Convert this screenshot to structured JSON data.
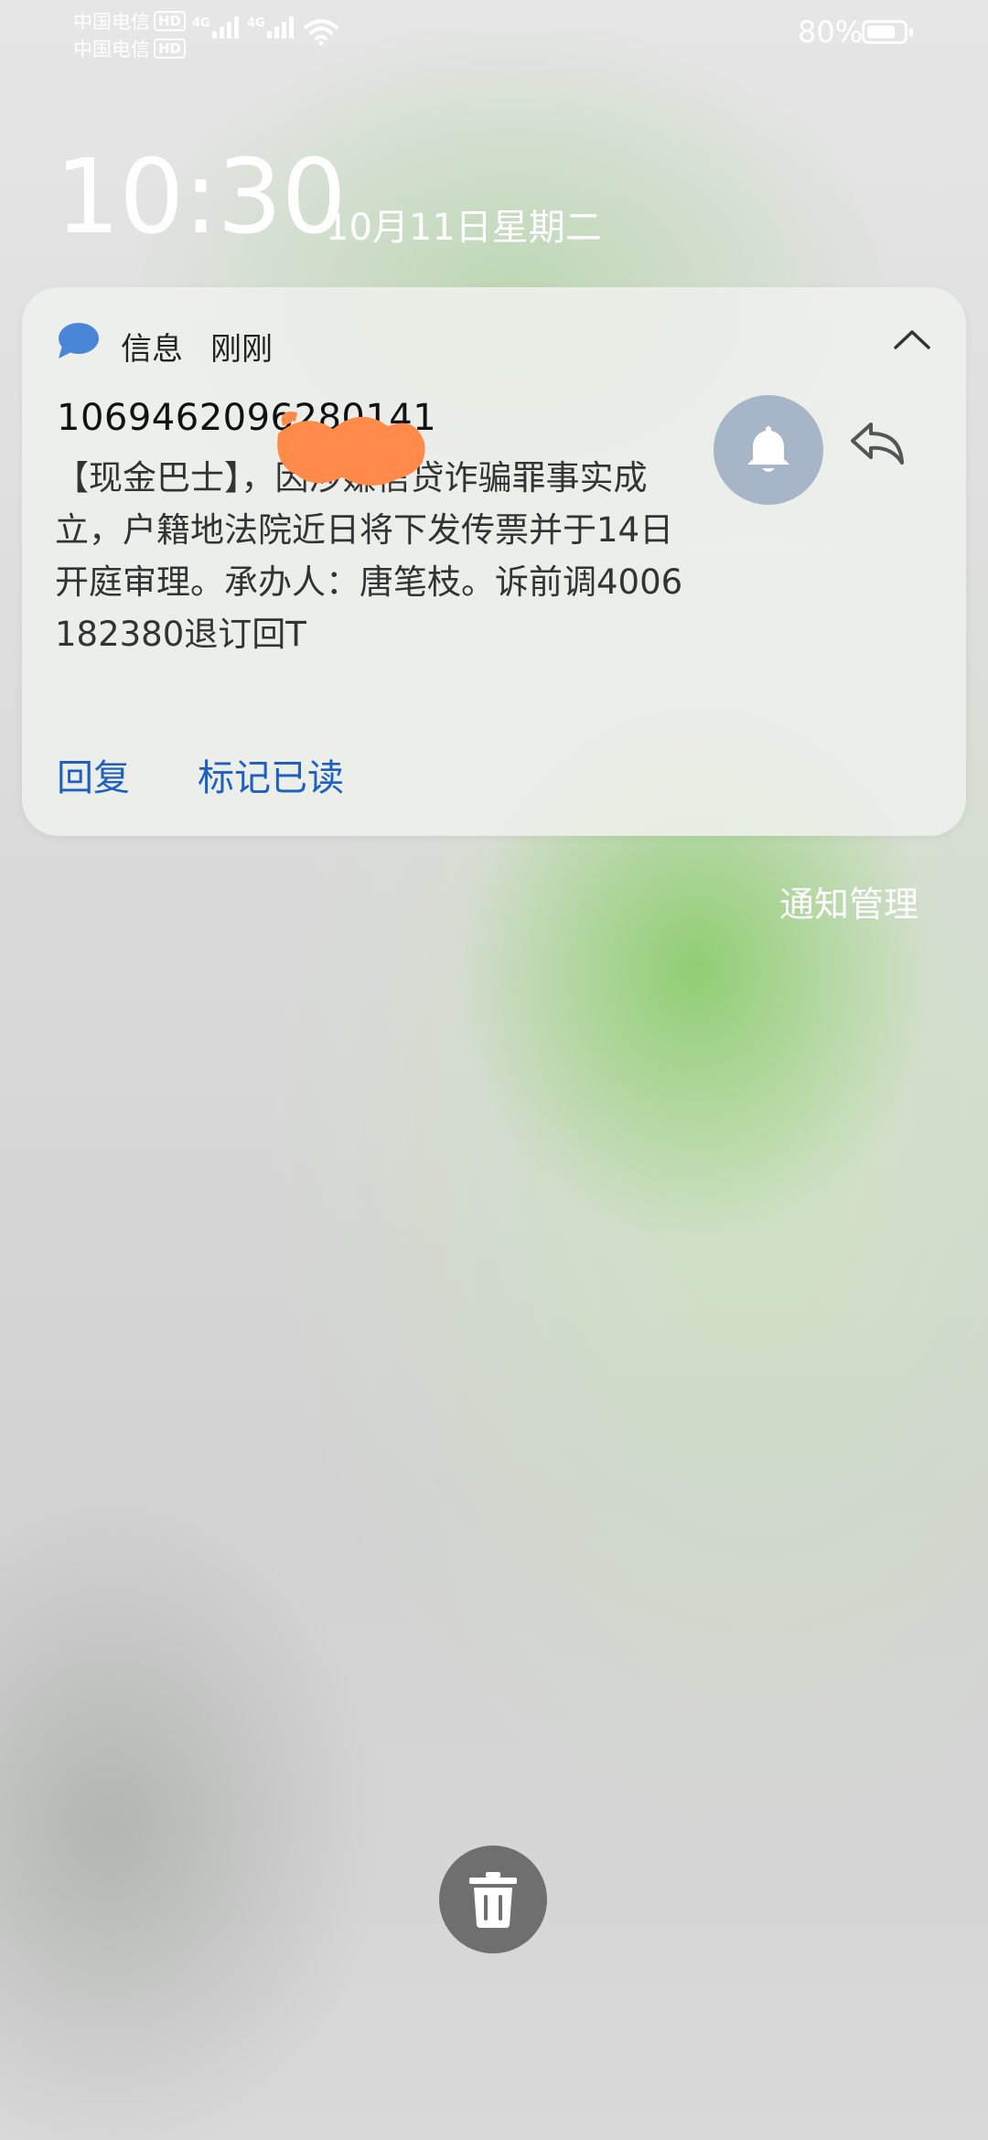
{
  "status_bar": {
    "carriers": [
      {
        "name": "中国电信",
        "badge": "HD"
      },
      {
        "name": "中国电信",
        "badge": "HD"
      }
    ],
    "networks": [
      "4G",
      "4G"
    ],
    "battery_percent": "80%",
    "battery_level": 0.8
  },
  "lockscreen": {
    "time": "10:30",
    "date": "10月11日星期二"
  },
  "notification": {
    "app_name": "信息",
    "time_ago": "刚刚",
    "sender": "1069462096280141",
    "body": "【现金巴士】，因涉嫌信贷诈骗罪事实成立，户籍地法院近日将下发传票并于14日开庭审理。承办人：唐笔枝。诉前调4006182380退订回T",
    "actions": {
      "reply": "回复",
      "mark_read": "标记已读"
    }
  },
  "notification_manage": "通知管理",
  "icons": {
    "app_icon": "message-bubble-icon",
    "collapse": "chevron-up-icon",
    "mute": "bell-icon",
    "reply": "reply-arrow-icon",
    "clear": "trash-icon"
  },
  "colors": {
    "link_blue": "#1f5fbf",
    "bell_button": "#a6b5c7",
    "trash_button": "#6f6f6f"
  }
}
